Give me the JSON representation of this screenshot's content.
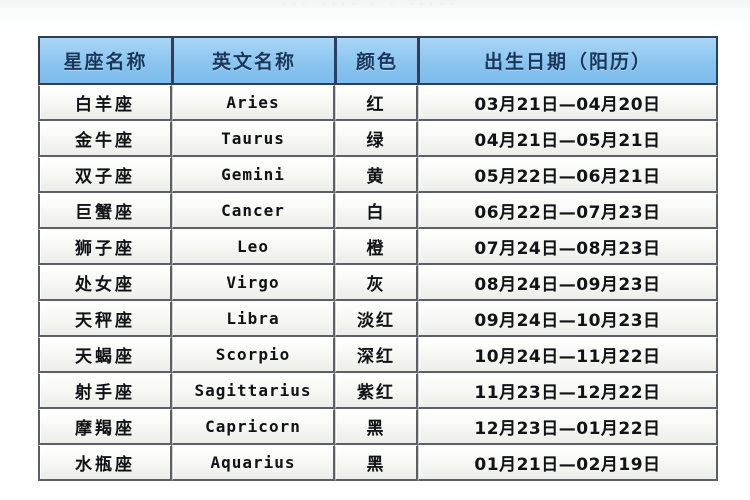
{
  "page": {
    "ghost_strip_text": "···  ····   · ·   ·····"
  },
  "table": {
    "headers": [
      {
        "label": "星座名称"
      },
      {
        "label": "英文名称"
      },
      {
        "label": "颜色"
      },
      {
        "label": "出生日期（阳历）"
      }
    ],
    "rows": [
      {
        "name": "白羊座",
        "english": "Aries",
        "color": "红",
        "date": "03月21日—04月20日"
      },
      {
        "name": "金牛座",
        "english": "Taurus",
        "color": "绿",
        "date": "04月21日—05月21日"
      },
      {
        "name": "双子座",
        "english": "Gemini",
        "color": "黄",
        "date": "05月22日—06月21日"
      },
      {
        "name": "巨蟹座",
        "english": "Cancer",
        "color": "白",
        "date": "06月22日—07月23日"
      },
      {
        "name": "狮子座",
        "english": "Leo",
        "color": "橙",
        "date": "07月24日—08月23日"
      },
      {
        "name": "处女座",
        "english": "Virgo",
        "color": "灰",
        "date": "08月24日—09月23日"
      },
      {
        "name": "天秤座",
        "english": "Libra",
        "color": "淡红",
        "date": "09月24日—10月23日"
      },
      {
        "name": "天蝎座",
        "english": "Scorpio",
        "color": "深红",
        "date": "10月24日—11月22日"
      },
      {
        "name": "射手座",
        "english": "Sagittarius",
        "color": "紫红",
        "date": "11月23日—12月22日"
      },
      {
        "name": "摩羯座",
        "english": "Capricorn",
        "color": "黑",
        "date": "12月23日—01月22日"
      },
      {
        "name": "水瓶座",
        "english": "Aquarius",
        "color": "黑",
        "date": "01月21日—02月19日"
      }
    ]
  },
  "colors": {
    "header_background": "#8cc3ec",
    "header_text": "#1d3a5e",
    "header_border": "#30415c",
    "cell_background": "#f1f1ee",
    "cell_border": "#5d6066",
    "cell_text": "#14161a",
    "page_background": "#ffffff"
  }
}
